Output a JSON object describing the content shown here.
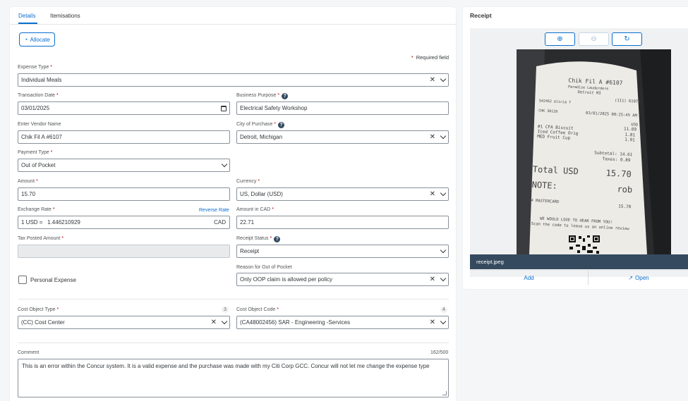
{
  "tabs": [
    {
      "label": "Details"
    },
    {
      "label": "Itemisations"
    }
  ],
  "allocate_label": "Allocate",
  "required_note": "Required field",
  "required_star": "*",
  "fields": {
    "expense_type": {
      "label": "Expense Type",
      "value": "Individual Meals"
    },
    "transaction_date": {
      "label": "Transaction Date",
      "value": "03/01/2025"
    },
    "business_purpose": {
      "label": "Business Purpose",
      "value": "Electrical Safety Workshop"
    },
    "vendor_name": {
      "label": "Enter Vendor Name",
      "value": "Chik Fil A #6107"
    },
    "city_of_purchase": {
      "label": "City of Purchase",
      "value": "Detroit, Michigan"
    },
    "payment_type": {
      "label": "Payment Type",
      "value": "Out of Pocket"
    },
    "amount": {
      "label": "Amount",
      "value": "15.70"
    },
    "currency": {
      "label": "Currency",
      "value": "US, Dollar (USD)"
    },
    "exchange_rate": {
      "label": "Exchange Rate",
      "value": "1 USD =   1.446210929",
      "unit": "CAD",
      "reverse_label": "Reverse Rate"
    },
    "amount_in_cad": {
      "label": "Amount in CAD",
      "value": "22.71"
    },
    "tax_posted_amount": {
      "label": "Tax Posted Amount",
      "value": ""
    },
    "receipt_status": {
      "label": "Receipt Status",
      "value": "Receipt"
    },
    "reason_oop": {
      "label": "Reason for Out of Pocket",
      "value": "Only OOP claim is allowed per policy"
    },
    "personal_expense": {
      "label": "Personal Expense",
      "checked": false
    },
    "cost_object_type": {
      "label": "Cost Object Type",
      "value": "(CC) Cost Center",
      "count": "3"
    },
    "cost_object_code": {
      "label": "Cost Object Code",
      "value": "(CA48002456) SAR - Engineering -Services",
      "count": "4"
    },
    "comment": {
      "label": "Comment",
      "counter": "162/500",
      "value": "This is an error within the Concur system.  It is a valid expense and the purchase was made with my Citi Corp GCC.  Concur will not let me change the expense type"
    }
  },
  "receipt_panel": {
    "title": "Receipt",
    "file_name": "receipt.jpeg",
    "add_label": "Add",
    "open_label": "Open",
    "image_text": {
      "store": "Chik Fil A #6107",
      "store_sub": "Paradise Lauderdere",
      "city": "Detroit MI",
      "phone": "(111) 61073",
      "order_line": "542462  alicia f",
      "order_no": "CHK 30128",
      "datetime": "03/01/2025  08:25:45 AM",
      "usd_hdr": "USD",
      "item1": "#1 CFA Biscuit",
      "item1_price": "11.09",
      "item2": "Iced Coffee Orig",
      "item2_price": "1.81",
      "item3": "MED Fruit Cup",
      "item3_price": "1.91",
      "subtotal": "Subtotal: 14.61",
      "taxes": "Taxes: 0.89",
      "total_label": "Total USD",
      "total_value": "15.70",
      "note_label": "NOTE:",
      "note_value": "rob",
      "card": "4 MASTERCARD",
      "card_amount": "15.70",
      "footer1": "WE WOULD LOVE TO HEAR FROM YOU!",
      "footer2": "Scan the code to leave us an online review"
    }
  },
  "colors": {
    "accent": "#0a6ed1",
    "required": "#bb0000",
    "file_bar": "#354a5f"
  }
}
